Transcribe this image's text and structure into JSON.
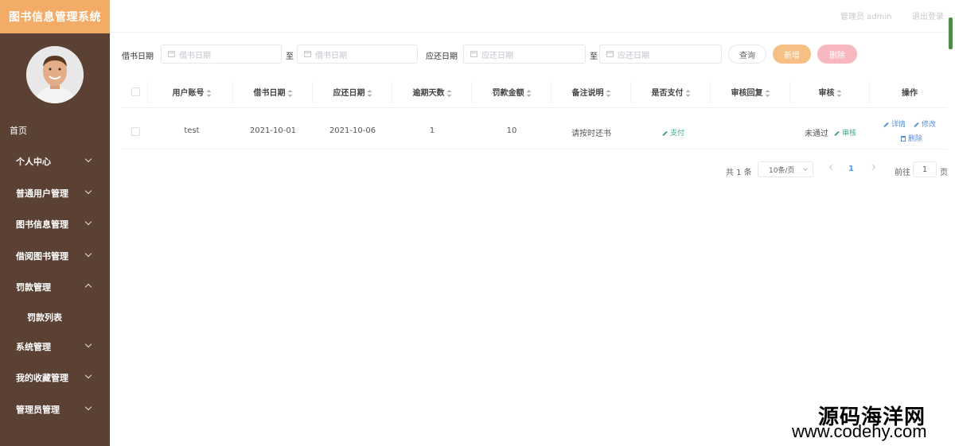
{
  "app": {
    "title": "图书信息管理系统"
  },
  "header": {
    "user": "管理员 admin",
    "logout": "退出登录"
  },
  "sidebar": {
    "home": "首页",
    "items": [
      {
        "label": "个人中心",
        "expanded": false
      },
      {
        "label": "普通用户管理",
        "expanded": false
      },
      {
        "label": "图书信息管理",
        "expanded": false
      },
      {
        "label": "借阅图书管理",
        "expanded": false
      },
      {
        "label": "罚款管理",
        "expanded": true,
        "children": [
          "罚款列表"
        ]
      },
      {
        "label": "系统管理",
        "expanded": false
      },
      {
        "label": "我的收藏管理",
        "expanded": false
      },
      {
        "label": "管理员管理",
        "expanded": false
      }
    ]
  },
  "search": {
    "borrow_date_label": "借书日期",
    "borrow_date_start_placeholder": "借书日期",
    "to_1": "至",
    "borrow_date_end_placeholder": "借书日期",
    "return_date_label": "应还日期",
    "return_date_start_placeholder": "应还日期",
    "to_2": "至",
    "return_date_end_placeholder": "应还日期",
    "query_label": "查询",
    "add_label": "新增",
    "delete_label": "删除"
  },
  "table": {
    "columns": [
      "用户账号",
      "借书日期",
      "应还日期",
      "逾期天数",
      "罚款金额",
      "备注说明",
      "是否支付",
      "审核回复",
      "审核",
      "操作"
    ],
    "rows": [
      {
        "account": "test",
        "borrow_date": "2021-10-01",
        "return_date": "2021-10-06",
        "overdue_days": "1",
        "fine_amount": "10",
        "remark": "请按时还书",
        "pay_action": "支付",
        "review_reply": "",
        "review_status": "未通过",
        "review_action": "审核",
        "actions": {
          "detail": "详情",
          "edit": "修改",
          "delete": "删除"
        }
      }
    ]
  },
  "pagination": {
    "total_text": "共 1 条",
    "page_size": "10条/页",
    "current_page": "1",
    "goto_label": "前往",
    "goto_value": "1",
    "page_unit": "页"
  },
  "watermark": {
    "line1": "源码海洋网",
    "line2": "www.codehy.com"
  },
  "colors": {
    "sidebar_bg": "#5a4134",
    "brand_bg": "#f2ac68",
    "add_btn": "#f5bf86",
    "delete_btn": "#f7b9bf",
    "link_green": "#3aa885",
    "link_blue": "#5a8fd6"
  }
}
